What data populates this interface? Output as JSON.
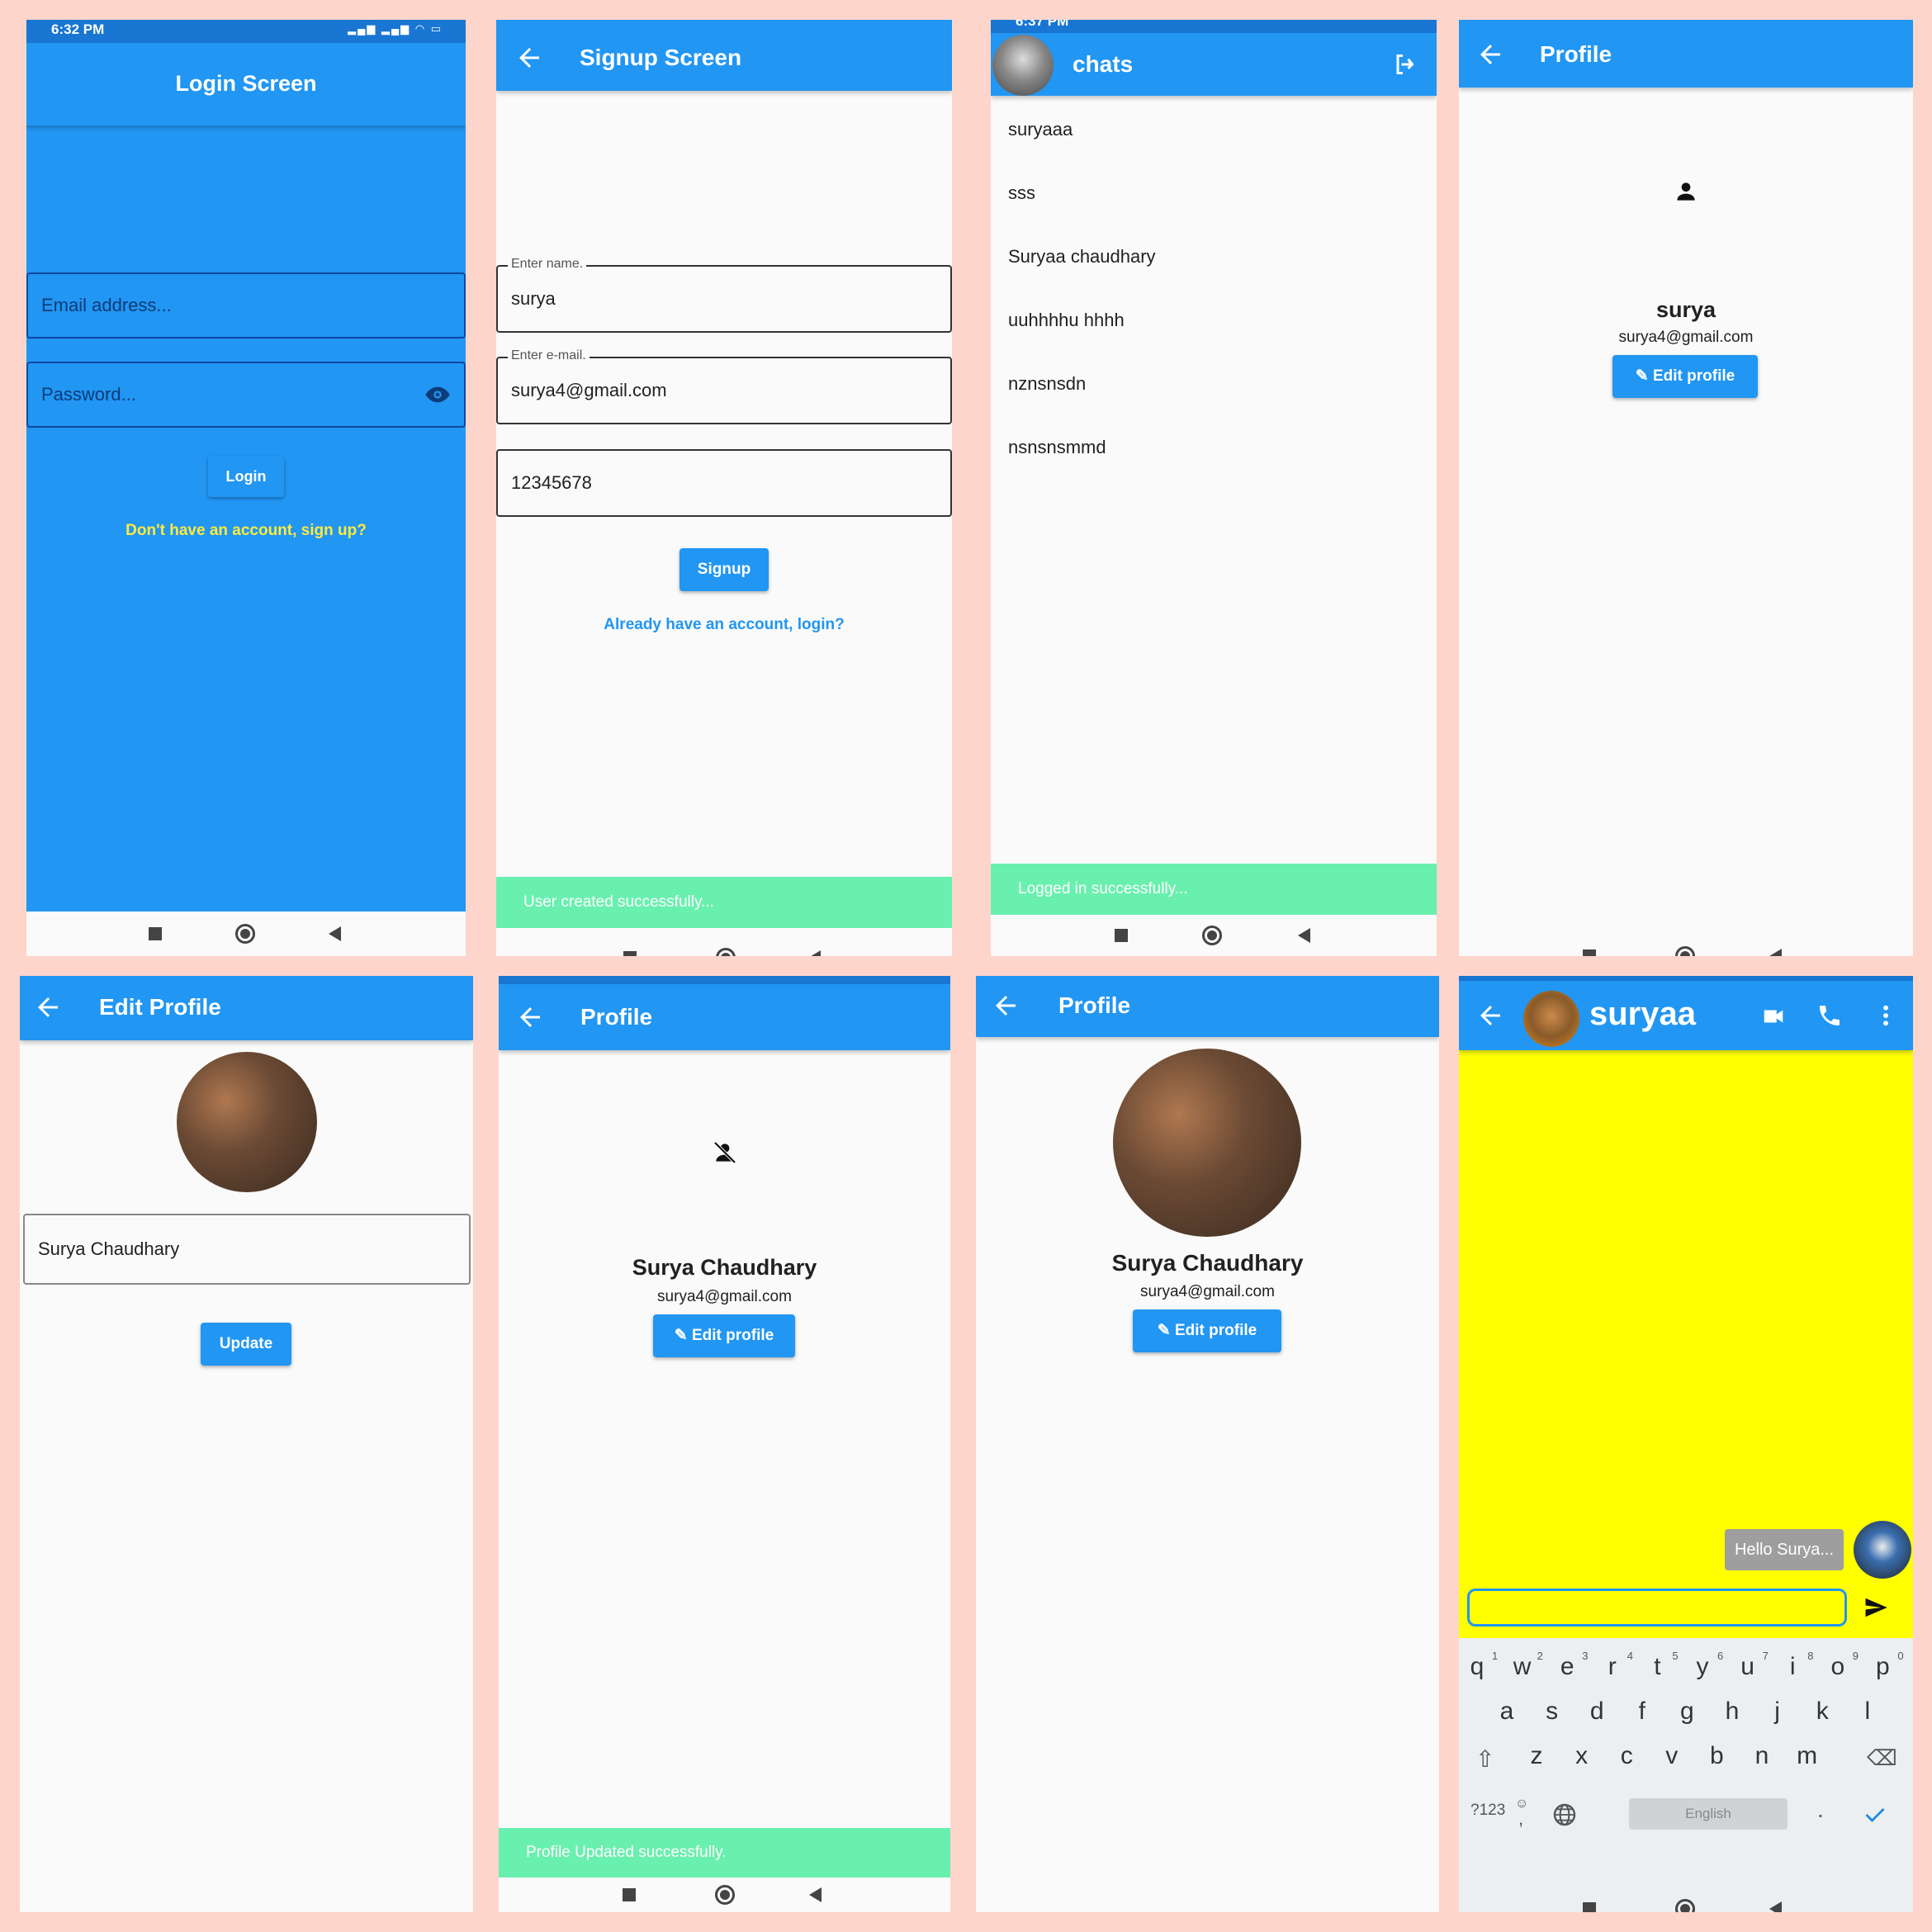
{
  "colors": {
    "primary": "#2196f3",
    "primary_dark": "#1976d2",
    "snackbar": "#69f0ae",
    "chat_bg": "#ffff00",
    "link_yellow": "#ffeb3b",
    "background": "#fdd5cb"
  },
  "login": {
    "status_time": "6:32 PM",
    "title": "Login Screen",
    "email_placeholder": "Email address...",
    "password_placeholder": "Password...",
    "login_button": "Login",
    "signup_link": "Don't have an account, sign up?"
  },
  "signup": {
    "title": "Signup Screen",
    "name_label": "Enter name.",
    "name_value": "surya",
    "email_label": "Enter e-mail.",
    "email_value": "surya4@gmail.com",
    "password_value": "12345678",
    "signup_button": "Signup",
    "login_link": "Already have an account, login?",
    "snackbar": "User created successfully..."
  },
  "chats": {
    "status_time": "6:37 PM",
    "title": "chats",
    "items": [
      "suryaaa",
      "sss",
      "Suryaa chaudhary",
      "uuhhhhu hhhh",
      "nznsnsdn",
      "nsnsnsmmd"
    ],
    "snackbar": "Logged in successfully..."
  },
  "profile1": {
    "title": "Profile",
    "name": "surya",
    "email": "surya4@gmail.com",
    "edit_button": "Edit profile"
  },
  "edit_profile": {
    "title": "Edit Profile",
    "name_value": "Surya Chaudhary",
    "update_button": "Update"
  },
  "profile2": {
    "title": "Profile",
    "name": "Surya Chaudhary",
    "email": "surya4@gmail.com",
    "edit_button": "Edit profile",
    "snackbar": "Profile Updated successfully."
  },
  "profile3": {
    "title": "Profile",
    "name": "Surya Chaudhary",
    "email": "surya4@gmail.com",
    "edit_button": "Edit profile"
  },
  "chat": {
    "title": "suryaa",
    "message": "Hello Surya...",
    "keyboard": {
      "row1": [
        "q",
        "w",
        "e",
        "r",
        "t",
        "y",
        "u",
        "i",
        "o",
        "p"
      ],
      "row1_numbers": [
        "1",
        "2",
        "3",
        "4",
        "5",
        "6",
        "7",
        "8",
        "9",
        "0"
      ],
      "row2": [
        "a",
        "s",
        "d",
        "f",
        "g",
        "h",
        "j",
        "k",
        "l"
      ],
      "row3": [
        "z",
        "x",
        "c",
        "v",
        "b",
        "n",
        "m"
      ],
      "symbols_key": "?123",
      "comma_key": ",",
      "space_label": "English",
      "period_key": "."
    }
  }
}
